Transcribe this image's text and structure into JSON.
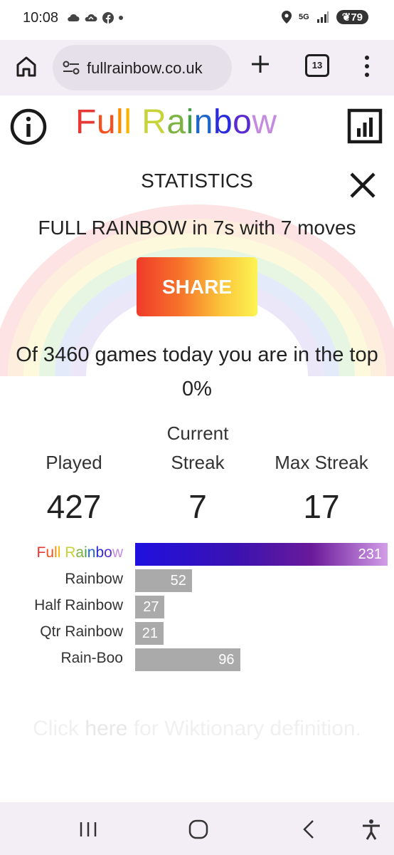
{
  "status": {
    "time": "10:08",
    "network": "5G",
    "battery": "79"
  },
  "browser": {
    "url": "fullrainbow.co.uk",
    "tab_count": "13"
  },
  "app": {
    "logo_letters": [
      {
        "ch": "F",
        "color": "#e53935"
      },
      {
        "ch": "u",
        "color": "#f4511e"
      },
      {
        "ch": "l",
        "color": "#fb8c00"
      },
      {
        "ch": "l",
        "color": "#fdb300"
      },
      {
        "ch": " ",
        "color": "#000000"
      },
      {
        "ch": "R",
        "color": "#c6d43a"
      },
      {
        "ch": "a",
        "color": "#7cb342"
      },
      {
        "ch": "i",
        "color": "#43a047"
      },
      {
        "ch": "n",
        "color": "#1e66c8"
      },
      {
        "ch": "b",
        "color": "#2a2adf"
      },
      {
        "ch": "o",
        "color": "#5a2bd0"
      },
      {
        "ch": "w",
        "color": "#c58ae0"
      }
    ]
  },
  "modal": {
    "title": "STATISTICS",
    "result": "FULL RAINBOW in 7s with 7 moves",
    "share_label": "SHARE",
    "games_text": "Of 3460 games today you are in the top 0%",
    "stats": [
      {
        "label_line1": "",
        "label_line2": "Played",
        "value": "427"
      },
      {
        "label_line1": "Current",
        "label_line2": "Streak",
        "value": "7"
      },
      {
        "label_line1": "",
        "label_line2": "Max Streak",
        "value": "17"
      }
    ],
    "wiktionary_pre": "Click ",
    "wiktionary_link": "here",
    "wiktionary_post": " for Wiktionary definition."
  },
  "chart_data": {
    "type": "bar",
    "orientation": "horizontal",
    "categories": [
      "Full Rainbow",
      "Rainbow",
      "Half Rainbow",
      "Qtr Rainbow",
      "Rain-Boo"
    ],
    "values": [
      231,
      52,
      27,
      21,
      96
    ],
    "xlim": [
      0,
      231
    ]
  },
  "colors": {
    "share_gradient": [
      "#ef3b2a",
      "#fdf452"
    ],
    "full_bar_gradient": [
      "#2010e0",
      "#d39ee8"
    ],
    "bar_gray": "#aaaaaa"
  }
}
